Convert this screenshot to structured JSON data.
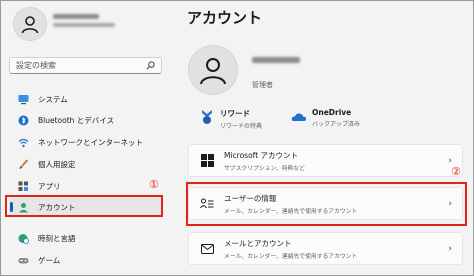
{
  "sidebar": {
    "search_placeholder": "設定の検索",
    "items": [
      {
        "label": "システム",
        "icon": "monitor-icon"
      },
      {
        "label": "Bluetooth とデバイス",
        "icon": "bluetooth-icon"
      },
      {
        "label": "ネットワークとインターネット",
        "icon": "wifi-icon"
      },
      {
        "label": "個人用設定",
        "icon": "brush-icon"
      },
      {
        "label": "アプリ",
        "icon": "apps-icon"
      },
      {
        "label": "アカウント",
        "icon": "person-icon",
        "active": true
      },
      {
        "label": "時刻と言語",
        "icon": "globe-clock-icon"
      },
      {
        "label": "ゲーム",
        "icon": "gamepad-icon"
      }
    ]
  },
  "annotations": {
    "step1": "①",
    "step2": "②"
  },
  "main": {
    "title": "アカウント",
    "role": "管理者",
    "services": [
      {
        "title": "リワード",
        "sub": "リワードの特典",
        "icon": "rewards-icon"
      },
      {
        "title": "OneDrive",
        "sub": "バックアップ済み",
        "icon": "onedrive-icon"
      }
    ],
    "cards": [
      {
        "title": "Microsoft アカウント",
        "sub": "サブスクリプション、特典など",
        "icon": "microsoft-logo-icon"
      },
      {
        "title": "ユーザーの情報",
        "sub": "メール、カレンダー、連絡先で使用するアカウント",
        "icon": "user-info-icon"
      },
      {
        "title": "メールとアカウント",
        "sub": "メール、カレンダー、連絡先で使用するアカウント",
        "icon": "mail-icon"
      }
    ],
    "chevron": "›"
  },
  "colors": {
    "accent": "#0067c0",
    "highlight": "#e2231a"
  }
}
